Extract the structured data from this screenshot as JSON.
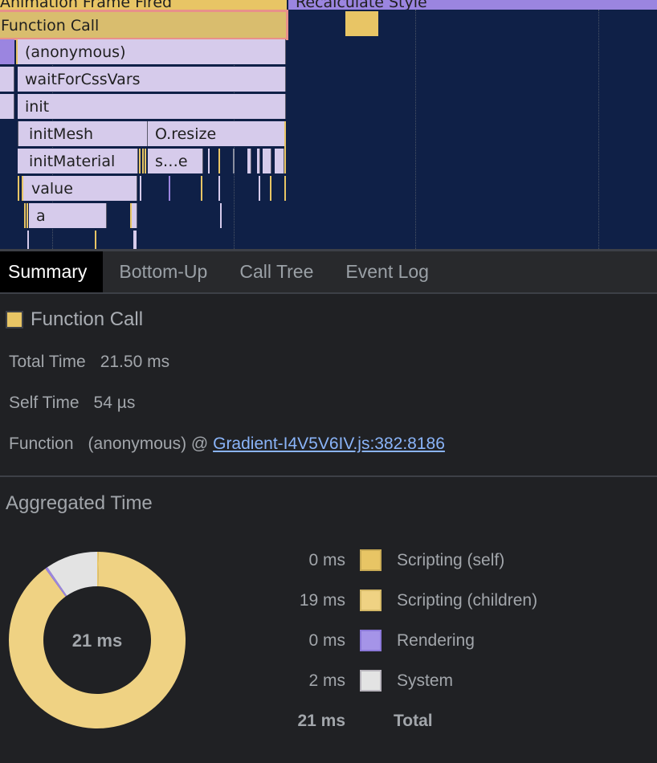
{
  "flame_chart": {
    "top_bars": [
      {
        "label": "Animation Frame Fired",
        "color": "#e8c565"
      },
      {
        "label": "Recalculate Style",
        "color": "#9b85e0"
      }
    ],
    "selected_bar": {
      "label": "Function Call",
      "color": "#dcbf6e",
      "outline": "#e8908a"
    },
    "frames": [
      {
        "label": "(anonymous)"
      },
      {
        "label": "waitForCssVars"
      },
      {
        "label": "init"
      },
      {
        "label": "initMesh"
      },
      {
        "label": "O.resize"
      },
      {
        "label": "initMaterial"
      },
      {
        "label": "s…e"
      },
      {
        "label": "value"
      },
      {
        "label": "a"
      }
    ]
  },
  "tabs": [
    {
      "label": "Summary",
      "active": true
    },
    {
      "label": "Bottom-Up",
      "active": false
    },
    {
      "label": "Call Tree",
      "active": false
    },
    {
      "label": "Event Log",
      "active": false
    }
  ],
  "summary": {
    "title": "Function Call",
    "title_color": "#e8c565",
    "total_time_label": "Total Time",
    "total_time_value": "21.50 ms",
    "self_time_label": "Self Time",
    "self_time_value": "54 µs",
    "function_label": "Function",
    "function_name": "(anonymous) @",
    "function_link": "Gradient-I4V5V6IV.js:382:8186"
  },
  "aggregated": {
    "title": "Aggregated Time",
    "center_label": "21 ms",
    "rows": [
      {
        "value": "0 ms",
        "name": "Scripting (self)",
        "color": "#e8c565"
      },
      {
        "value": "19 ms",
        "name": "Scripting (children)",
        "color": "#efd283"
      },
      {
        "value": "0 ms",
        "name": "Rendering",
        "color": "#9b85e0"
      },
      {
        "value": "2 ms",
        "name": "System",
        "color": "#e3e3e3"
      }
    ],
    "total": {
      "value": "21 ms",
      "name": "Total"
    }
  },
  "chart_data": {
    "type": "pie",
    "title": "Aggregated Time",
    "center_label": "21 ms",
    "categories": [
      "Scripting (self)",
      "Scripting (children)",
      "Rendering",
      "System"
    ],
    "values": [
      0.054,
      19.3,
      0.1,
      2.05
    ],
    "units": "ms",
    "colors": [
      "#e8c565",
      "#efd283",
      "#9b85e0",
      "#e3e3e3"
    ],
    "donut": true
  }
}
